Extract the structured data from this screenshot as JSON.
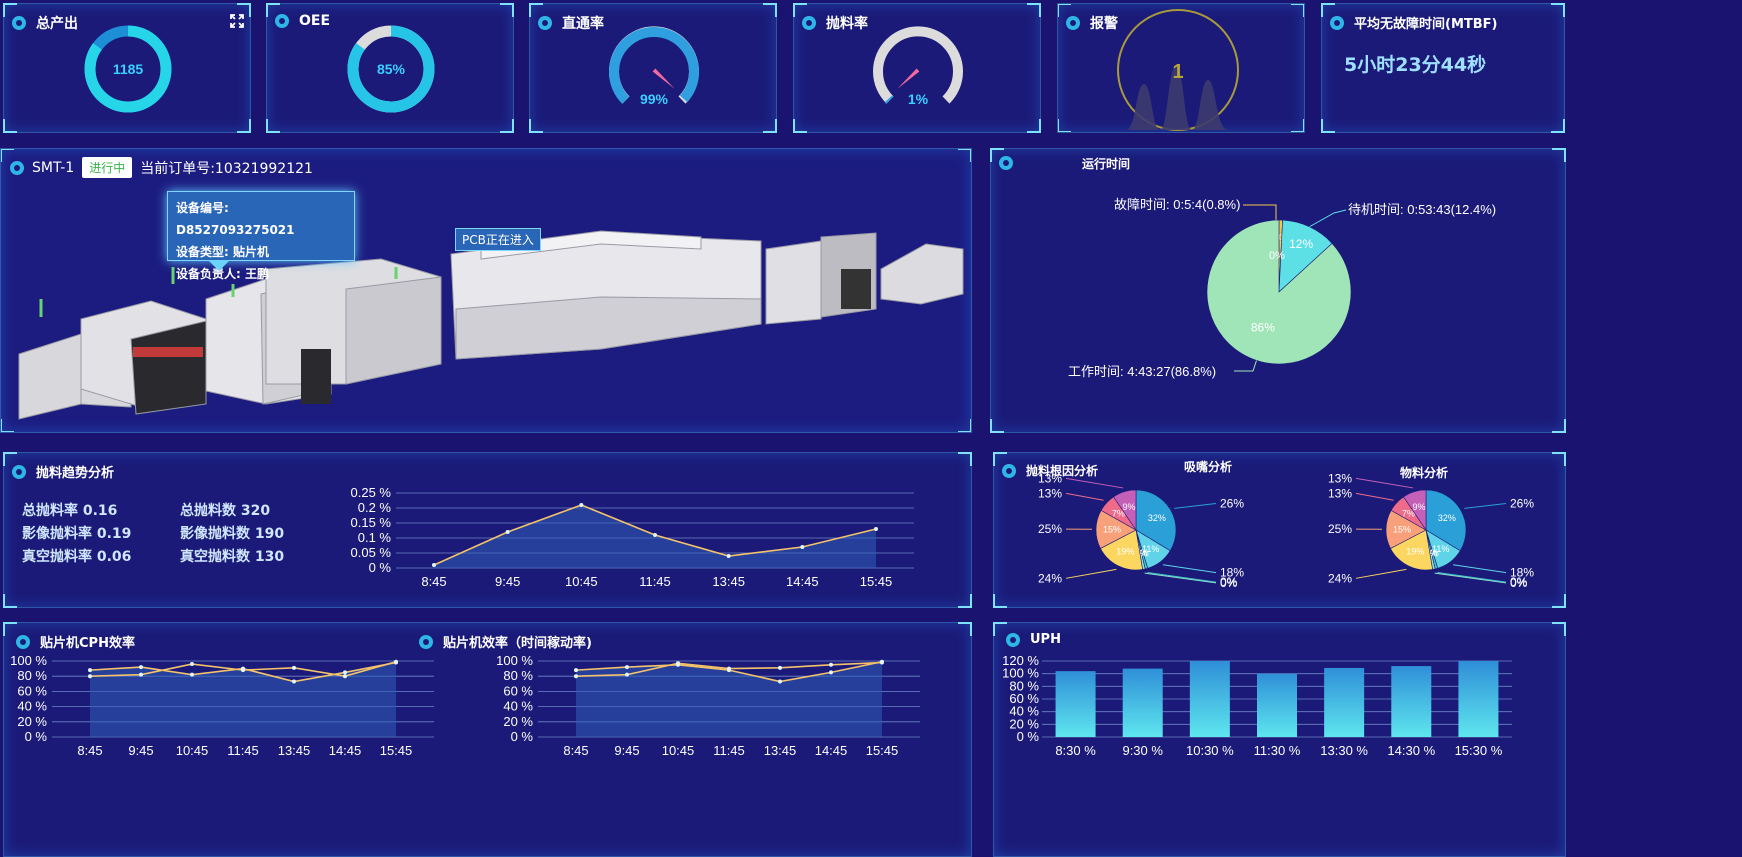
{
  "kpis": {
    "output": {
      "title": "总产出",
      "value": "1185",
      "ratio": 0.85
    },
    "oee": {
      "title": "OEE",
      "value": "85%",
      "ratio": 0.85
    },
    "fpy": {
      "title": "直通率",
      "value": "99%",
      "ratio": 0.99
    },
    "throw": {
      "title": "抛料率",
      "value": "1%",
      "ratio": 0.01
    },
    "alarm": {
      "title": "报警",
      "value": "1"
    },
    "mtbf": {
      "title": "平均无故障时间(MTBF)",
      "value": "5小时23分44秒"
    }
  },
  "line": {
    "name": "SMT-1",
    "status": "进行中",
    "order": "当前订单号:10321992121",
    "tooltip": {
      "code": "设备编号: D8527093275021",
      "type": "设备类型: 贴片机",
      "owner": "设备负责人: 王鹏"
    },
    "pcb_label": "PCB正在进入"
  },
  "runtime": {
    "title": "运行时间",
    "labels": {
      "fault": "故障时间: 0:5:4(0.8%)",
      "idle": "待机时间: 0:53:43(12.4%)",
      "work": "工作时间: 4:43:27(86.8%)"
    },
    "slices": [
      {
        "name": "fault",
        "value": 0.8,
        "pct": "1%",
        "color": "#f4c84a"
      },
      {
        "name": "idle",
        "value": 12.4,
        "pct": "12%",
        "color": "#5ddfe6"
      },
      {
        "name": "work",
        "value": 86.8,
        "pct": "86%",
        "color": "#9fe5b8"
      }
    ],
    "extra_label": "0%"
  },
  "throw_trend": {
    "title": "抛料趋势分析",
    "stats": [
      {
        "label": "总抛料率",
        "value": "0.16"
      },
      {
        "label": "总抛料数",
        "value": "320"
      },
      {
        "label": "影像抛料率",
        "value": "0.19"
      },
      {
        "label": "影像抛料数",
        "value": "190"
      },
      {
        "label": "真空抛料率",
        "value": "0.06"
      },
      {
        "label": "真空抛料数",
        "value": "130"
      }
    ]
  },
  "root_cause": {
    "title": "抛料根因分析",
    "charts": [
      {
        "title": "吸嘴分析"
      },
      {
        "title": "物料分析"
      }
    ],
    "slices": [
      {
        "value": 32,
        "color": "#2a9fd8",
        "inner": "32%",
        "outer": "26%"
      },
      {
        "value": 11,
        "color": "#5fd3e8",
        "inner": "11%",
        "outer": "18%"
      },
      {
        "value": 1,
        "color": "#3ec7c9",
        "inner": "0%",
        "outer": "0%"
      },
      {
        "value": 1,
        "color": "#8fe0d0",
        "inner": "0%",
        "outer": "0%"
      },
      {
        "value": 19,
        "color": "#fbd660",
        "inner": "19%",
        "outer": "24%"
      },
      {
        "value": 15,
        "color": "#f7a07a",
        "inner": "15%",
        "outer": "25%"
      },
      {
        "value": 7,
        "color": "#ef6b8a",
        "inner": "7%",
        "outer": "13%"
      },
      {
        "value": 9,
        "color": "#c460b8",
        "inner": "9%",
        "outer": "13%"
      }
    ]
  },
  "cph": {
    "title": "贴片机CPH效率"
  },
  "eff": {
    "title": "贴片机效率（时间稼动率)"
  },
  "uph": {
    "title": "UPH"
  },
  "chart_data": [
    {
      "type": "area",
      "title": "抛料趋势分析",
      "categories": [
        "8:45",
        "9:45",
        "10:45",
        "11:45",
        "13:45",
        "14:45",
        "15:45"
      ],
      "yticks": [
        "0 %",
        "0.05 %",
        "0.1 %",
        "0.15 %",
        "0.2 %",
        "0.25 %"
      ],
      "ylim": [
        0,
        0.25
      ],
      "series": [
        {
          "values": [
            0.01,
            0.12,
            0.21,
            0.11,
            0.04,
            0.07,
            0.13
          ]
        }
      ]
    },
    {
      "type": "line",
      "title": "贴片机CPH效率",
      "categories": [
        "8:45",
        "9:45",
        "10:45",
        "11:45",
        "13:45",
        "14:45",
        "15:45"
      ],
      "yticks": [
        "0 %",
        "20 %",
        "40 %",
        "60 %",
        "80 %",
        "100 %"
      ],
      "ylim": [
        0,
        100
      ],
      "series": [
        {
          "values": [
            88,
            92,
            82,
            90,
            73,
            85,
            98
          ]
        },
        {
          "values": [
            80,
            82,
            96,
            88,
            91,
            80,
            99
          ]
        }
      ]
    },
    {
      "type": "line",
      "title": "贴片机效率（时间稼动率)",
      "categories": [
        "8:45",
        "9:45",
        "10:45",
        "11:45",
        "13:45",
        "14:45",
        "15:45"
      ],
      "yticks": [
        "0 %",
        "20 %",
        "40 %",
        "60 %",
        "80 %",
        "100 %"
      ],
      "ylim": [
        0,
        100
      ],
      "series": [
        {
          "values": [
            88,
            92,
            95,
            88,
            73,
            85,
            99
          ]
        },
        {
          "values": [
            80,
            82,
            97,
            90,
            91,
            95,
            98
          ]
        }
      ]
    },
    {
      "type": "bar",
      "title": "UPH",
      "categories": [
        "8:30 %",
        "9:30 %",
        "10:30 %",
        "11:30 %",
        "13:30 %",
        "14:30 %",
        "15:30 %"
      ],
      "yticks": [
        "0 %",
        "20 %",
        "40 %",
        "60 %",
        "80 %",
        "100 %",
        "120 %"
      ],
      "ylim": [
        0,
        120
      ],
      "values": [
        104,
        108,
        120,
        100,
        109,
        112,
        120
      ]
    }
  ]
}
